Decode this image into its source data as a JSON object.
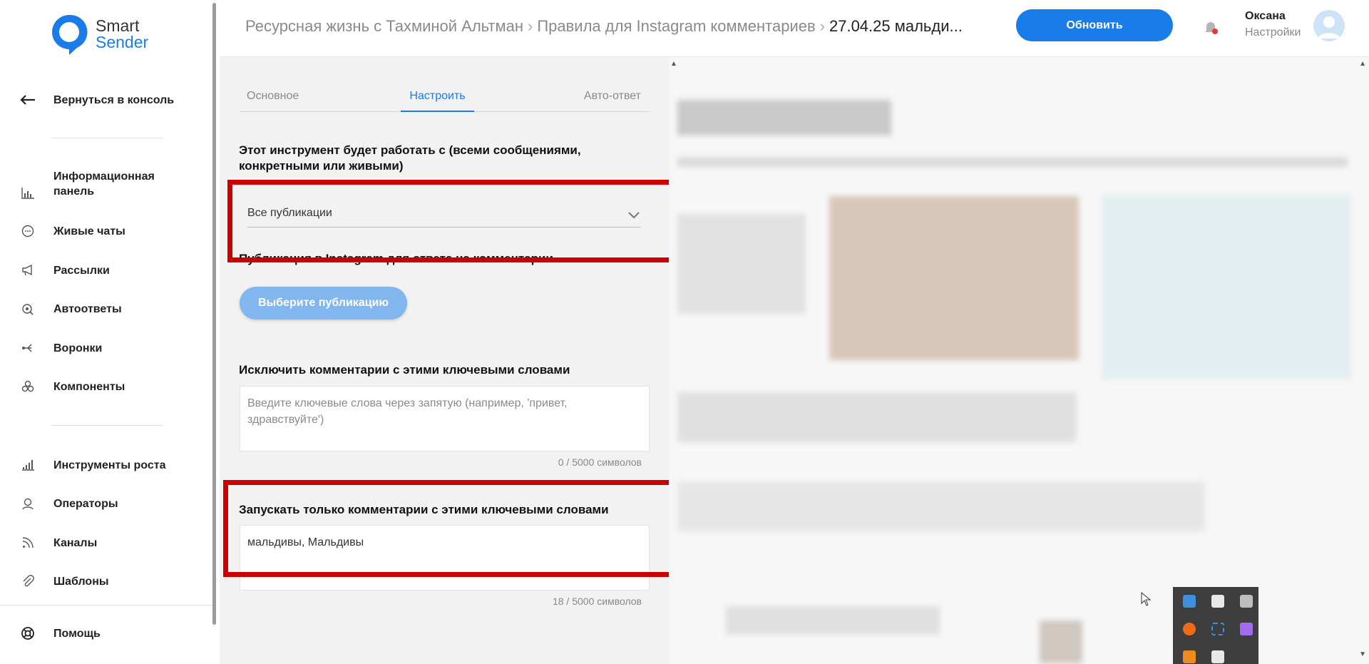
{
  "brand": {
    "line1": "Smart",
    "line2": "Sender"
  },
  "sidebar": {
    "back": "Вернуться в консоль",
    "items": [
      {
        "label": "Информационная панель",
        "icon": "chart-icon"
      },
      {
        "label": "Живые чаты",
        "icon": "chat-icon"
      },
      {
        "label": "Рассылки",
        "icon": "megaphone-icon"
      },
      {
        "label": "Автоответы",
        "icon": "autoreply-icon"
      },
      {
        "label": "Воронки",
        "icon": "funnel-icon"
      },
      {
        "label": "Компоненты",
        "icon": "components-icon"
      }
    ],
    "items2": [
      {
        "label": "Инструменты роста",
        "icon": "growth-icon"
      },
      {
        "label": "Операторы",
        "icon": "operator-icon"
      },
      {
        "label": "Каналы",
        "icon": "rss-icon"
      },
      {
        "label": "Шаблоны",
        "icon": "clip-icon"
      }
    ],
    "help": "Помощь"
  },
  "header": {
    "crumb1": "Ресурсная жизнь с Тахминой Альтман",
    "crumb2": "Правила для Instagram комментариев",
    "crumb3": "27.04.25 мальди...",
    "update_label": "Обновить",
    "user_name": "Оксана",
    "user_settings": "Настройки"
  },
  "tabs": [
    "Основное",
    "Настроить",
    "Авто-ответ"
  ],
  "active_tab": "Настроить",
  "form": {
    "scope_title": "Этот инструмент будет работать с (всеми сообщениями, конкретными или живыми)",
    "scope_value": "Все публикации",
    "publication_label": "Публикация в Instagram для ответа на комментарии",
    "publication_button": "Выберите публикацию",
    "exclude_title": "Исключить комментарии с этими ключевыми словами",
    "exclude_placeholder": "Введите ключевые слова через запятую (например, 'привет, здравствуйте')",
    "exclude_counter": "0 / 5000 символов",
    "include_title": "Запускать только комментарии с этими ключевыми словами",
    "include_value": "мальдивы, Мальдивы",
    "include_counter": "18 / 5000 символов"
  },
  "colors": {
    "accent": "#1a7ce8",
    "highlight": "#cc0000",
    "panel": "#f2f2f2"
  }
}
